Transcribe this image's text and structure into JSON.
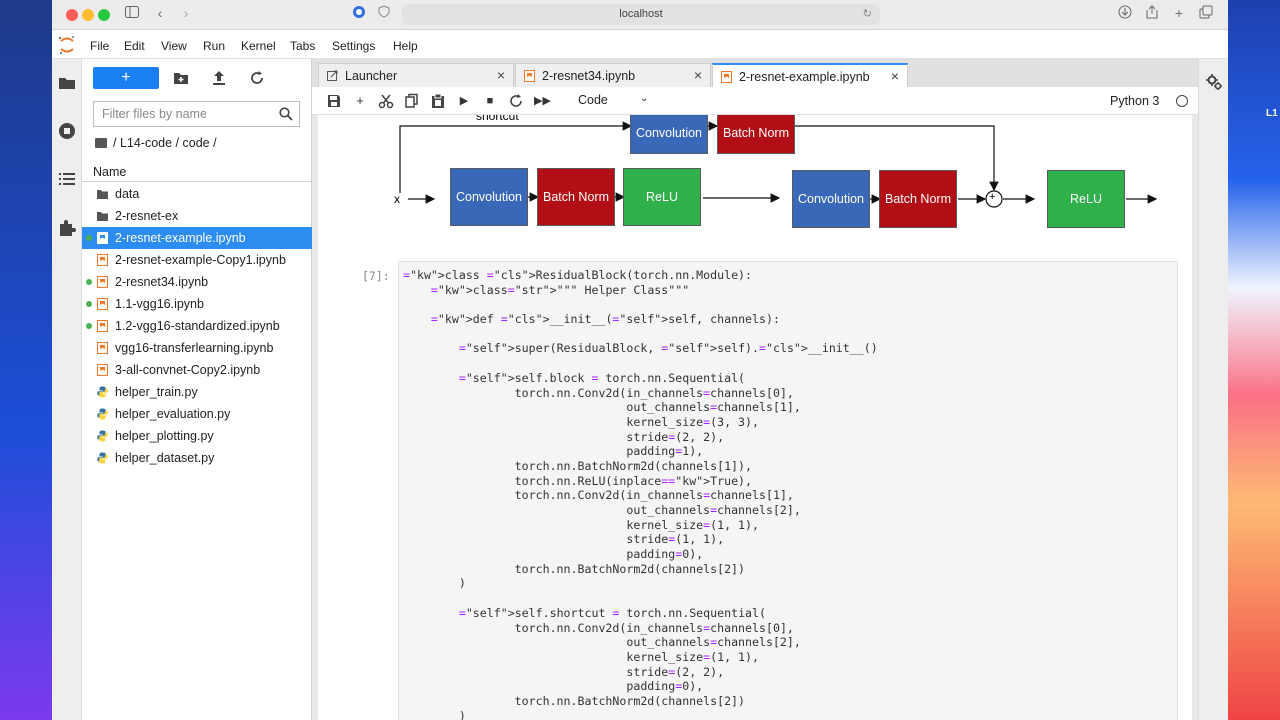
{
  "browser": {
    "url": "localhost"
  },
  "menubar": {
    "items": [
      "File",
      "Edit",
      "View",
      "Run",
      "Kernel",
      "Tabs",
      "Settings",
      "Help"
    ]
  },
  "filebrowser": {
    "new_button_label": "+",
    "filter_placeholder": "Filter files by name",
    "breadcrumb": "/ L14-code / code /",
    "column_header": "Name",
    "files": [
      {
        "name": "data",
        "type": "folder",
        "running": false,
        "selected": false
      },
      {
        "name": "2-resnet-ex",
        "type": "folder",
        "running": false,
        "selected": false
      },
      {
        "name": "2-resnet-example.ipynb",
        "type": "notebook",
        "running": true,
        "selected": true
      },
      {
        "name": "2-resnet-example-Copy1.ipynb",
        "type": "notebook",
        "running": false,
        "selected": false
      },
      {
        "name": "2-resnet34.ipynb",
        "type": "notebook",
        "running": true,
        "selected": false
      },
      {
        "name": "1.1-vgg16.ipynb",
        "type": "notebook",
        "running": true,
        "selected": false
      },
      {
        "name": "1.2-vgg16-standardized.ipynb",
        "type": "notebook",
        "running": true,
        "selected": false
      },
      {
        "name": "vgg16-transferlearning.ipynb",
        "type": "notebook",
        "running": false,
        "selected": false
      },
      {
        "name": "3-all-convnet-Copy2.ipynb",
        "type": "notebook",
        "running": false,
        "selected": false
      },
      {
        "name": "helper_train.py",
        "type": "python",
        "running": false,
        "selected": false
      },
      {
        "name": "helper_evaluation.py",
        "type": "python",
        "running": false,
        "selected": false
      },
      {
        "name": "helper_plotting.py",
        "type": "python",
        "running": false,
        "selected": false
      },
      {
        "name": "helper_dataset.py",
        "type": "python",
        "running": false,
        "selected": false
      }
    ]
  },
  "tabs": [
    {
      "label": "Launcher",
      "active": false
    },
    {
      "label": "2-resnet34.ipynb",
      "active": false
    },
    {
      "label": "2-resnet-example.ipynb",
      "active": true
    }
  ],
  "notebook_toolbar": {
    "cell_type": "Code",
    "kernel": "Python 3"
  },
  "diagram": {
    "shortcut_label": "shortcut",
    "input_label": "x",
    "sum_symbol": "+",
    "blocks": {
      "conv": "Convolution",
      "bn": "Batch Norm",
      "relu": "ReLU"
    }
  },
  "cell": {
    "prompt": "[7]:",
    "code_lines": [
      "class ResidualBlock(torch.nn.Module):",
      "    \"\"\" Helper Class\"\"\"",
      "",
      "    def __init__(self, channels):",
      "",
      "        super(ResidualBlock, self).__init__()",
      "",
      "        self.block = torch.nn.Sequential(",
      "                torch.nn.Conv2d(in_channels=channels[0],",
      "                                out_channels=channels[1],",
      "                                kernel_size=(3, 3),",
      "                                stride=(2, 2),",
      "                                padding=1),",
      "                torch.nn.BatchNorm2d(channels[1]),",
      "                torch.nn.ReLU(inplace=True),",
      "                torch.nn.Conv2d(in_channels=channels[1],",
      "                                out_channels=channels[2],",
      "                                kernel_size=(1, 1),",
      "                                stride=(1, 1),",
      "                                padding=0),",
      "                torch.nn.BatchNorm2d(channels[2])",
      "        )",
      "",
      "        self.shortcut = torch.nn.Sequential(",
      "                torch.nn.Conv2d(in_channels=channels[0],",
      "                                out_channels=channels[2],",
      "                                kernel_size=(1, 1),",
      "                                stride=(2, 2),",
      "                                padding=0),",
      "                torch.nn.BatchNorm2d(channels[2])",
      "        )"
    ]
  },
  "desktop": {
    "corner_label": "L1"
  }
}
